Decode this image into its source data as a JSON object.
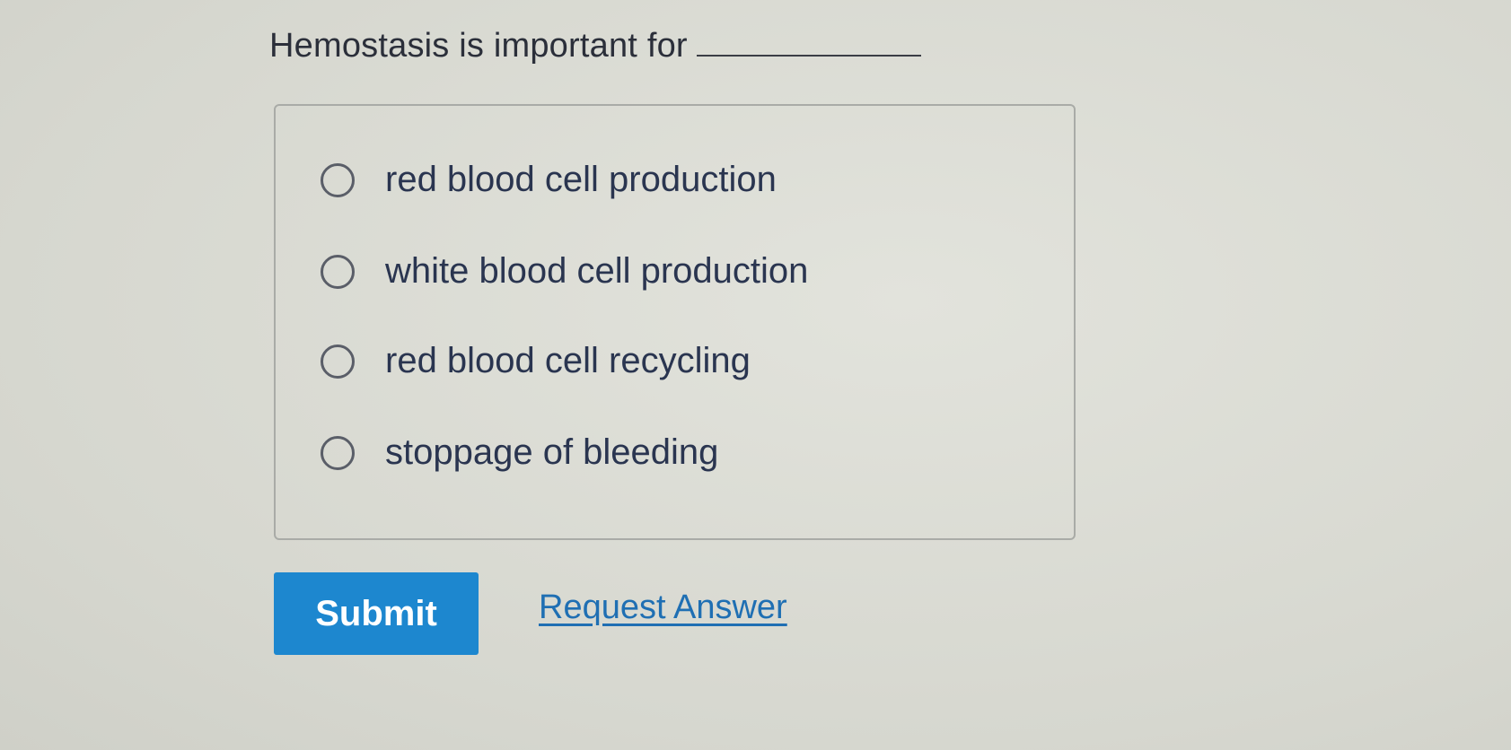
{
  "question": {
    "text": "Hemostasis is important for"
  },
  "options": [
    {
      "label": "red blood cell production",
      "selected": false
    },
    {
      "label": "white blood cell production",
      "selected": false
    },
    {
      "label": "red blood cell recycling",
      "selected": false
    },
    {
      "label": "stoppage of bleeding",
      "selected": false
    }
  ],
  "actions": {
    "submit_label": "Submit",
    "request_answer_label": "Request Answer"
  },
  "colors": {
    "submit_bg": "#1d87cf",
    "link": "#1f6fb3",
    "text": "#2a3550"
  }
}
